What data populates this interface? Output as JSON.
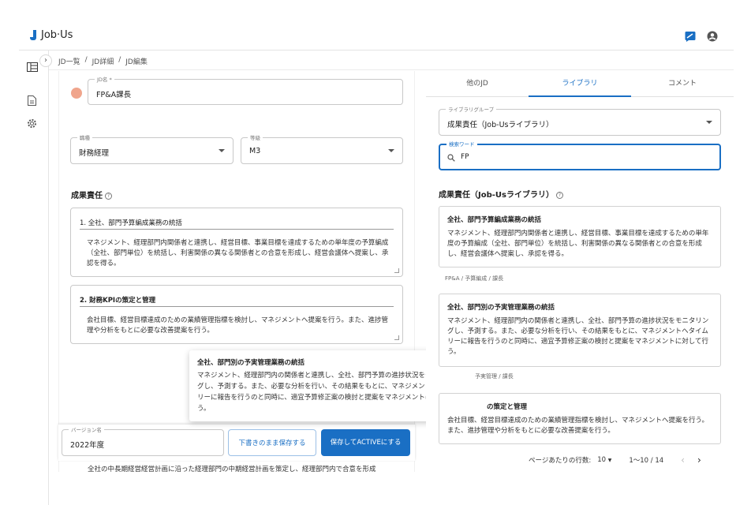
{
  "app": {
    "name": "Job·Us"
  },
  "breadcrumb": [
    "JD一覧",
    "JD詳細",
    "JD編集"
  ],
  "breadcrumb_sep": "/",
  "form": {
    "jd_name_label": "JD名 *",
    "jd_name_value": "FP&A課長",
    "job_type_label": "職種",
    "job_type_value": "財務経理",
    "grade_label": "等級",
    "grade_value": "M3",
    "section_title": "成果責任",
    "responsibilities": [
      {
        "title": "1. 全社、部門予算編成業務の統括",
        "body": "マネジメント、経理部門内関係者と連携し、経営目標、事業目標を達成するための単年度の予算編成（全社、部門単位）を統括し、利害関係の異なる関係者との合意を形成し、経営会議体へ提案し、承認を得る。"
      },
      {
        "title": "2. 財務KPIの策定と管理",
        "body": "会社目標、経営目標達成のための業績管理指標を検討し、マネジメントへ提案を行う。また、進捗管理や分析をもとに必要な改善提案を行う。"
      }
    ],
    "partial_text": "全社の中長期経営経営計画に沿った経理部門の中期経営計画を策定し、経理部門内で合意を形成"
  },
  "tooltip": {
    "title": "全社、部門別の予実管理業務の統括",
    "body": "マネジメント、経理部門内の関係者と連携し、全社、部門予算の進捗状況をモニタリングし、予測する。また、必要な分析を行い、その結果をもとに、マネジメントへタイムリーに報告を行うのと同時に、適宜予算修正案の検討と提案をマネジメントに対して行う。"
  },
  "savebar": {
    "version_label": "バージョン名",
    "version_value": "2022年度",
    "save_draft": "下書きのまま保存する",
    "save_active": "保存してACTIVEにする"
  },
  "right": {
    "tabs": [
      "他のJD",
      "ライブラリ",
      "コメント"
    ],
    "active_tab": 1,
    "library_group_label": "ライブラリグループ",
    "library_group_value": "成果責任（Job-Usライブラリ）",
    "search_label": "検索ワード",
    "search_value": "FP",
    "section_title": "成果責任（Job-Usライブラリ）",
    "cards": [
      {
        "title": "全社、部門予算編成業務の統括",
        "body": "マネジメント、経理部門内関係者と連携し、経営目標、事業目標を達成するための単年度の予算編成（全社、部門単位）を統括し、利害関係の異なる関係者との合意を形成し、経営会議体へ提案し、承認を得る。",
        "tag": "FP&A / 予算編成 / 課長"
      },
      {
        "title": "全社、部門別の予実管理業務の統括",
        "body": "マネジメント、経理部門内の関係者と連携し、全社、部門予算の進捗状況をモニタリングし、予測する。また、必要な分析を行い、その結果をもとに、マネジメントへタイムリーに報告を行うのと同時に、適宜予算修正案の検討と提案をマネジメントに対して行う。",
        "tag": "予実管理 / 課長"
      },
      {
        "title": "の策定と管理",
        "body": "会社目標、経営目標達成のための業績管理指標を検討し、マネジメントへ提案を行う。また、進捗管理や分析をもとに必要な改善提案を行う。"
      }
    ],
    "pager": {
      "rows_label": "ページあたりの行数:",
      "rows_value": "10",
      "range": "1〜10 / 14"
    }
  },
  "colors": {
    "accent": "#1a6fc4",
    "avatar": "#f0a58c"
  }
}
